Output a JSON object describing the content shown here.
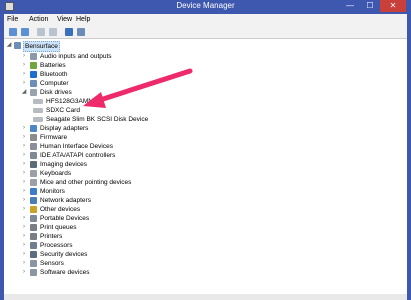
{
  "window": {
    "title": "Device Manager",
    "controls": {
      "minimize": "—",
      "maximize": "☐",
      "close": "✕"
    }
  },
  "menu": [
    "File",
    "Action",
    "View",
    "Help"
  ],
  "toolbar": [
    "back-icon",
    "forward-icon",
    "properties-icon",
    "scan-icon",
    "help-icon",
    "display-icon"
  ],
  "tree": {
    "root": "Bensurface",
    "categories": [
      "Audio inputs and outputs",
      "Batteries",
      "Bluetooth",
      "Computer",
      "Disk drives",
      "Display adapters",
      "Firmware",
      "Human Interface Devices",
      "IDE ATA/ATAPI controllers",
      "Imaging devices",
      "Keyboards",
      "Mice and other pointing devices",
      "Monitors",
      "Network adapters",
      "Other devices",
      "Portable Devices",
      "Print queues",
      "Printers",
      "Processors",
      "Security devices",
      "Sensors",
      "Software devices"
    ],
    "disk_drives": [
      "HFS128G3AMN",
      "SDXC Card",
      "Seagate Slim  BK SCSI Disk Device"
    ]
  },
  "annotation": {
    "arrow_color": "#ee2a6b"
  }
}
